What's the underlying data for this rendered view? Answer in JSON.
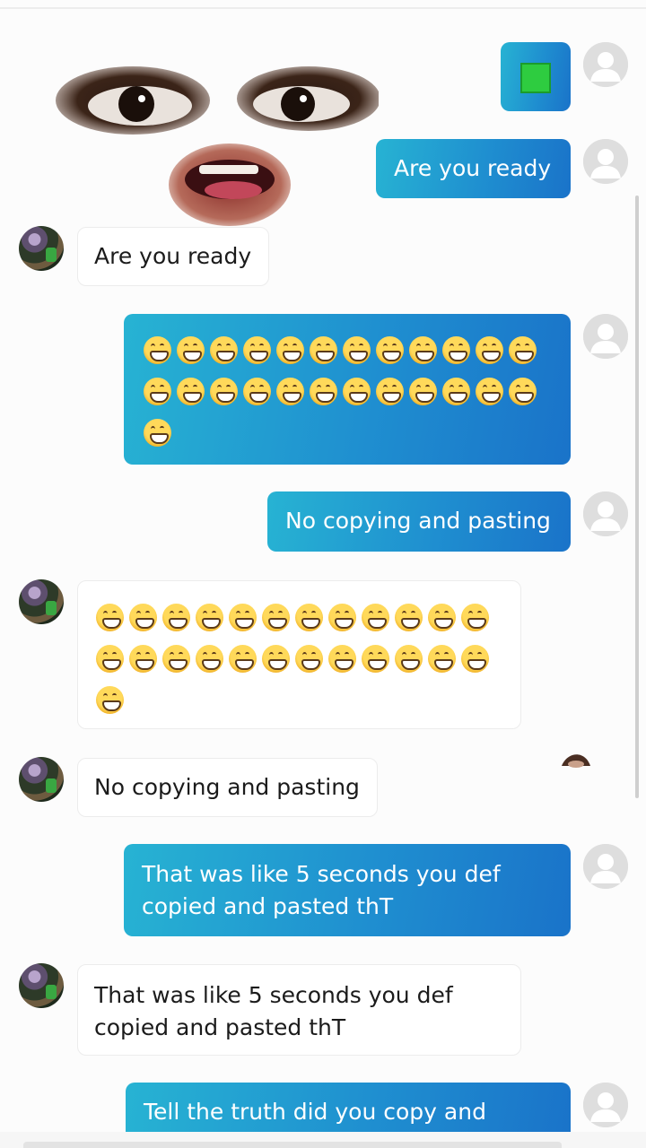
{
  "messages": {
    "m1": {
      "text": "Are you ready"
    },
    "m2": {
      "text": "Are you ready"
    },
    "m3": {
      "emoji_count": 25
    },
    "m4": {
      "text": "No copying and pasting"
    },
    "m5": {
      "emoji_count": 25
    },
    "m6": {
      "text": "No copying and pasting"
    },
    "m7": {
      "text": "That was like 5 seconds you def\ncopied and pasted thT"
    },
    "m8": {
      "text": "That was like 5 seconds you def\ncopied and pasted thT"
    },
    "m9": {
      "text": "Tell the truth did you copy and paste"
    }
  },
  "icons": {
    "user_avatar": "default-user-avatar-icon",
    "friend_avatar": "friend-profile-photo",
    "emoji": "grinning-face-with-smiling-eyes-emoji",
    "green_square": "green-square-emoji",
    "sticker_face": "eyes-and-mouth-sticker",
    "small_sticker": "small-brown-sticker"
  },
  "colors": {
    "outgoing_bubble_start": "#27b3d3",
    "outgoing_bubble_end": "#1a73c9",
    "incoming_bubble": "#ffffff",
    "background": "#fcfcfc"
  }
}
